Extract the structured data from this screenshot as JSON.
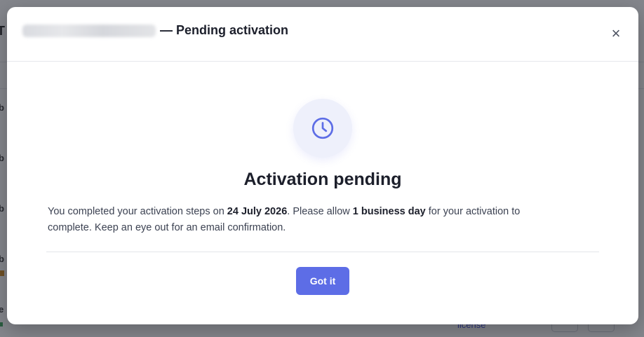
{
  "modal": {
    "title_suffix": "— Pending activation",
    "close_label": "×",
    "heading": "Activation pending",
    "message": {
      "part1": "You completed your activation steps on ",
      "date": "24 July 2026",
      "part2": ". Please allow ",
      "duration": "1 business day",
      "part3": " for your activation to complete. Keep an eye out for an email confirmation."
    },
    "confirm_label": "Got it"
  },
  "background": {
    "title_fragment": "T",
    "link_text": "license"
  },
  "colors": {
    "accent": "#5d6de6",
    "icon_bg": "#eef0fb",
    "overlay": "#1f232d"
  },
  "icons": {
    "status": "clock-icon",
    "close": "close-icon"
  }
}
